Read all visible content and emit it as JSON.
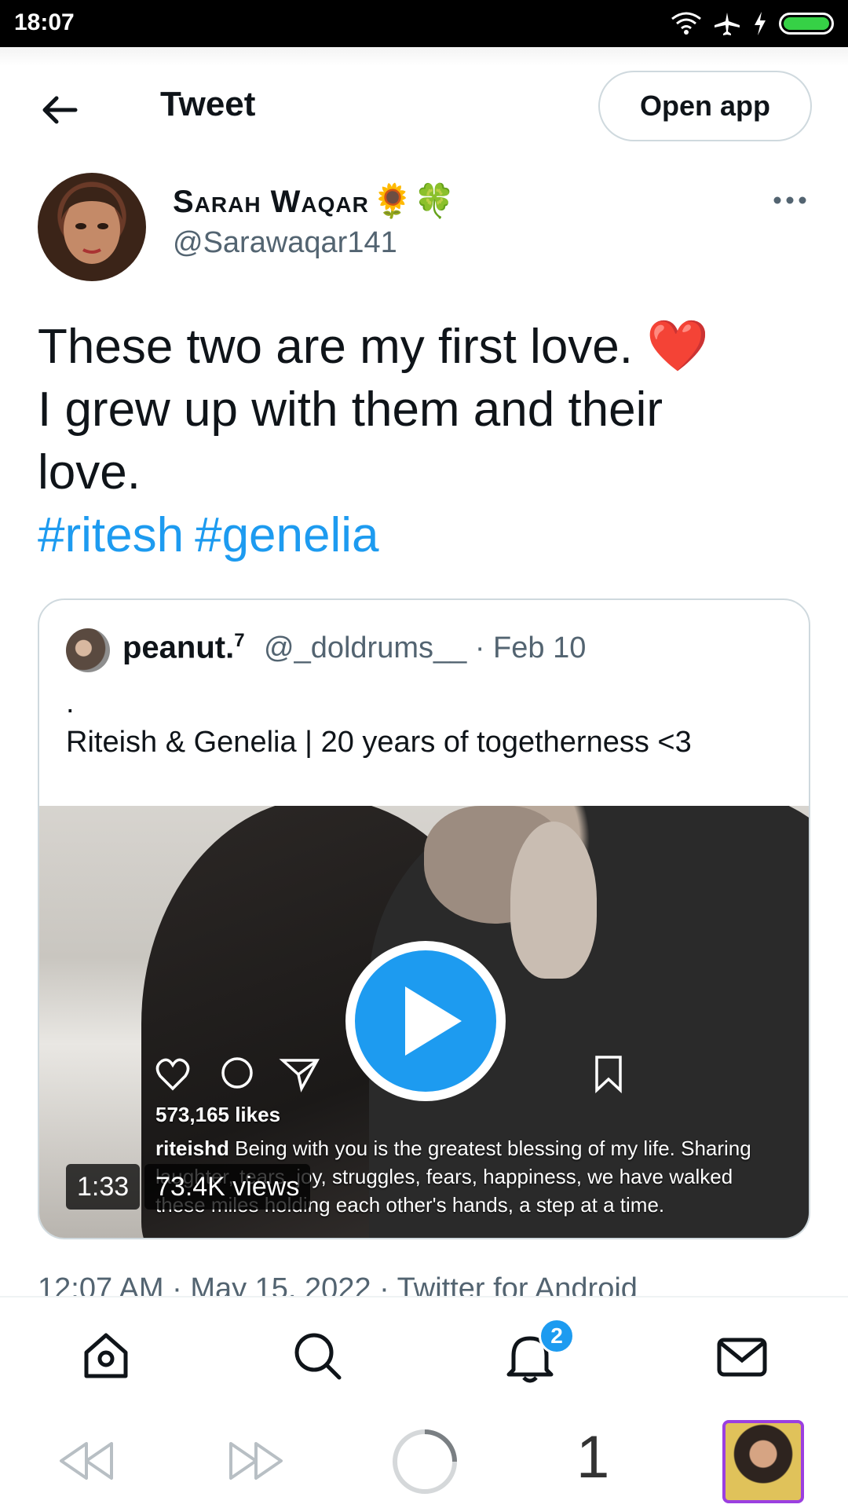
{
  "status_bar": {
    "time": "18:07"
  },
  "header": {
    "title": "Tweet",
    "open_app_label": "Open app"
  },
  "author": {
    "name": "Sarah Waqar",
    "emojis": "🌻🍀",
    "handle": "@Sarawaqar141"
  },
  "tweet": {
    "line1": "These two are my first love.",
    "heart": "❤️",
    "line2": "I grew up with them and their",
    "line3": "love.",
    "hashtags": [
      "#ritesh",
      "#genelia"
    ]
  },
  "quoted_tweet": {
    "name": "peanut.",
    "name_sup": "7",
    "meta": "@_doldrums__ · Feb 10",
    "dot": ".",
    "text": "Riteish & Genelia | 20 years of togetherness <3",
    "video": {
      "duration": "1:33",
      "views": "73.4K views",
      "overlay_likes": "573,165 likes",
      "overlay_user": "riteishd",
      "overlay_caption": "Being with you is the greatest blessing of my life. Sharing laughter, tears, joy, struggles, fears, happiness, we have walked these miles holding each other's hands, a step at a time."
    }
  },
  "timestamp": "12:07 AM · May 15, 2022 · Twitter for Android",
  "bottom_nav": {
    "notification_count": "2"
  },
  "browser_bar": {
    "tab_count": "1"
  },
  "colors": {
    "accent": "#1d9bf0",
    "heart": "#e0245e",
    "text": "#0f1419",
    "muted": "#536471"
  }
}
